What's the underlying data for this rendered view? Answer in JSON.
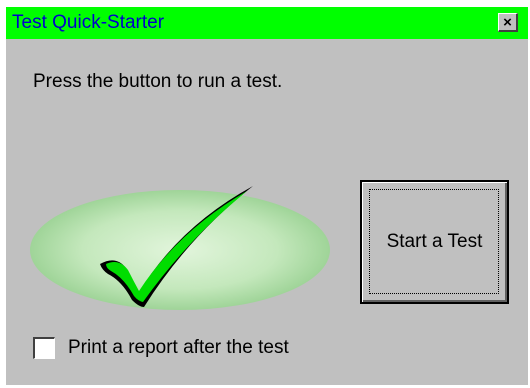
{
  "window": {
    "title": "Test Quick-Starter",
    "title_bar_color": "#00ff00",
    "title_text_color": "#0000cc",
    "close_glyph": "×"
  },
  "main": {
    "prompt": "Press the button to run a test.",
    "start_button_label": "Start a Test",
    "illustration": "green-checkmark-icon"
  },
  "options": {
    "print_report_label": "Print a report after the test",
    "print_report_checked": false
  }
}
